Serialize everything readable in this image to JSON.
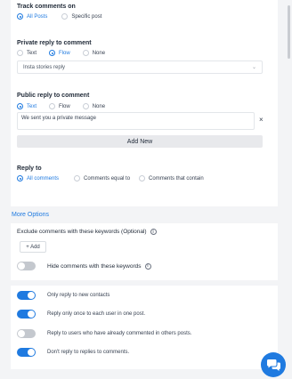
{
  "track": {
    "title": "Track comments on",
    "options": [
      {
        "label": "All Posts",
        "selected": true
      },
      {
        "label": "Specific post",
        "selected": false
      }
    ]
  },
  "private_reply": {
    "title": "Private reply to comment",
    "options": [
      {
        "label": "Text",
        "selected": false
      },
      {
        "label": "Flow",
        "selected": true
      },
      {
        "label": "None",
        "selected": false
      }
    ],
    "select_value": "Insta stories reply"
  },
  "public_reply": {
    "title": "Public reply to comment",
    "options": [
      {
        "label": "Text",
        "selected": true
      },
      {
        "label": "Flow",
        "selected": false
      },
      {
        "label": "None",
        "selected": false
      }
    ],
    "message": "We sent you a private message",
    "add_new_label": "Add New"
  },
  "reply_to": {
    "title": "Reply to",
    "options": [
      {
        "label": "All comments",
        "selected": true
      },
      {
        "label": "Comments equal to",
        "selected": false
      },
      {
        "label": "Comments that contain",
        "selected": false
      }
    ]
  },
  "more_options_label": "More Options",
  "keywords": {
    "exclude_label": "Exclude comments with these keywords (Optional)",
    "add_label": "+ Add",
    "hide_label": "Hide comments with these keywords",
    "hide_enabled": false
  },
  "options": [
    {
      "label": "Only reply to new contacts",
      "enabled": true
    },
    {
      "label": "Reply only once to each user in one post.",
      "enabled": true
    },
    {
      "label": "Reply to users who have already commented in others posts.",
      "enabled": false
    },
    {
      "label": "Don't reply to replies to comments.",
      "enabled": true
    }
  ],
  "colors": {
    "accent": "#1f7ae0",
    "toggle_off": "#c4c8ce",
    "background": "#f3f4f6"
  }
}
